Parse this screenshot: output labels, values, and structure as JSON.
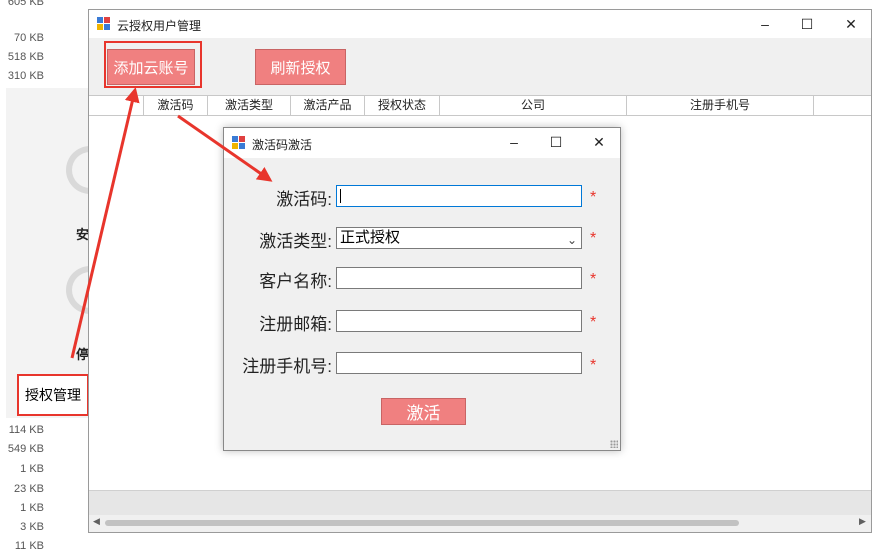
{
  "background": {
    "file_sizes_top": [
      "605 KB",
      "70 KB",
      "518 KB",
      "310 KB"
    ],
    "file_sizes_bottom": [
      "114 KB",
      "549 KB",
      "1 KB",
      "23 KB",
      "1 KB",
      "3 KB",
      "11 KB"
    ],
    "fragments": [
      "安",
      "停"
    ],
    "auth_tab_label": "授权管理"
  },
  "main_window": {
    "title": "云授权用户管理",
    "toolbar": {
      "add_account_label": "添加云账号",
      "refresh_label": "刷新授权"
    },
    "columns": [
      "激活码",
      "激活类型",
      "激活产品",
      "授权状态",
      "公司",
      "注册手机号"
    ]
  },
  "dialog": {
    "title": "激活码激活",
    "fields": [
      {
        "label": "激活码:",
        "value": "",
        "required_mark": "*"
      },
      {
        "label": "激活类型:",
        "value": "正式授权",
        "required_mark": "*"
      },
      {
        "label": "客户名称:",
        "value": "",
        "required_mark": "*"
      },
      {
        "label": "注册邮箱:",
        "value": "",
        "required_mark": "*"
      },
      {
        "label": "注册手机号:",
        "value": "",
        "required_mark": "*"
      }
    ],
    "activate_label": "激活"
  },
  "window_controls": {
    "minimize": "–",
    "maximize": "☐",
    "close": "✕"
  },
  "colors": {
    "accent_button": "#f08080",
    "highlight_red": "#e8352c",
    "focus_blue": "#0078d7"
  }
}
